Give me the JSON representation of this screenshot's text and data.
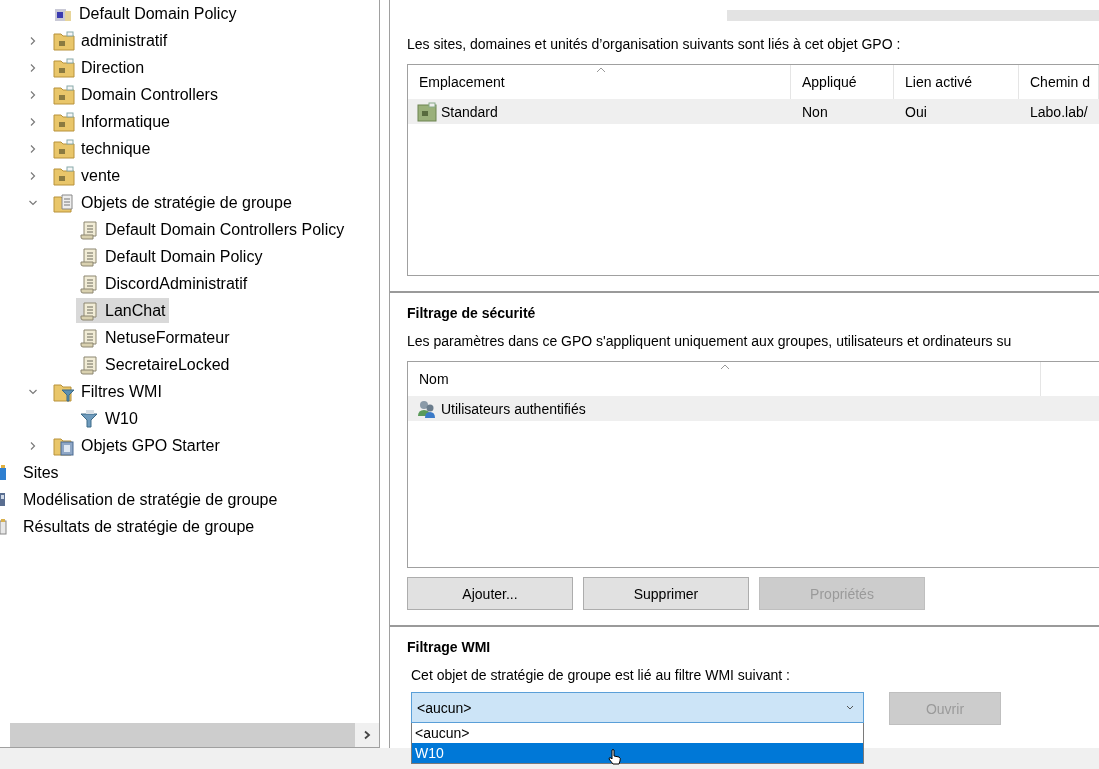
{
  "tree": {
    "domain_items": [
      {
        "label": "Default Domain Policy",
        "kind": "gpo-link",
        "selected": false
      },
      {
        "label": "administratif",
        "kind": "ou",
        "expanded": false,
        "selected": false
      },
      {
        "label": "Direction",
        "kind": "ou",
        "expanded": false,
        "selected": false
      },
      {
        "label": "Domain Controllers",
        "kind": "ou",
        "expanded": false,
        "selected": false
      },
      {
        "label": "Informatique",
        "kind": "ou",
        "expanded": false,
        "selected": false
      },
      {
        "label": "technique",
        "kind": "ou",
        "expanded": false,
        "selected": false
      },
      {
        "label": "vente",
        "kind": "ou",
        "expanded": false,
        "selected": false
      },
      {
        "label": "Objets de stratégie de groupe",
        "kind": "gpo-folder",
        "expanded": true,
        "selected": false,
        "children": [
          {
            "label": "Default Domain Controllers Policy",
            "kind": "gpo",
            "selected": false
          },
          {
            "label": "Default Domain Policy",
            "kind": "gpo",
            "selected": false
          },
          {
            "label": "DiscordAdministratif",
            "kind": "gpo",
            "selected": false
          },
          {
            "label": "LanChat",
            "kind": "gpo",
            "selected": true
          },
          {
            "label": "NetuseFormateur",
            "kind": "gpo",
            "selected": false
          },
          {
            "label": "SecretaireLocked",
            "kind": "gpo",
            "selected": false
          }
        ]
      },
      {
        "label": "Filtres WMI",
        "kind": "wmi-folder",
        "expanded": true,
        "selected": false,
        "children": [
          {
            "label": "W10",
            "kind": "wmi-filter",
            "selected": false
          }
        ]
      },
      {
        "label": "Objets GPO Starter",
        "kind": "starter-folder",
        "expanded": false,
        "selected": false
      }
    ],
    "root_items": [
      {
        "label": "Sites",
        "kind": "sites",
        "selected": false
      },
      {
        "label": "Modélisation de stratégie de groupe",
        "kind": "modeling",
        "selected": false
      },
      {
        "label": "Résultats de stratégie de groupe",
        "kind": "results",
        "selected": false
      }
    ]
  },
  "links": {
    "intro": "Les sites, domaines et unités d’organisation suivants sont liés à cet objet GPO :",
    "columns": [
      "Emplacement",
      "Appliqué",
      "Lien activé",
      "Chemin d"
    ],
    "rows": [
      {
        "cells": [
          "Standard",
          "Non",
          "Oui",
          "Labo.lab/"
        ],
        "selected": true
      }
    ]
  },
  "security": {
    "title": "Filtrage de sécurité",
    "intro": "Les paramètres dans ce GPO s'appliquent uniquement aux groupes, utilisateurs et ordinateurs su",
    "columns": [
      "Nom"
    ],
    "rows": [
      {
        "cells": [
          "Utilisateurs authentifiés"
        ],
        "selected": true
      }
    ],
    "buttons": [
      {
        "label": "Ajouter...",
        "disabled": false
      },
      {
        "label": "Supprimer",
        "disabled": false
      },
      {
        "label": "Propriétés",
        "disabled": true
      }
    ]
  },
  "wmi": {
    "title": "Filtrage WMI",
    "intro": "Cet objet de stratégie de groupe est lié au filtre WMI suivant :",
    "combo": {
      "value": "<aucun>",
      "expanded": true,
      "options": [
        {
          "label": "<aucun>",
          "highlighted": false
        },
        {
          "label": "W10",
          "highlighted": true
        }
      ]
    },
    "open_button": {
      "label": "Ouvrir",
      "disabled": true
    }
  }
}
